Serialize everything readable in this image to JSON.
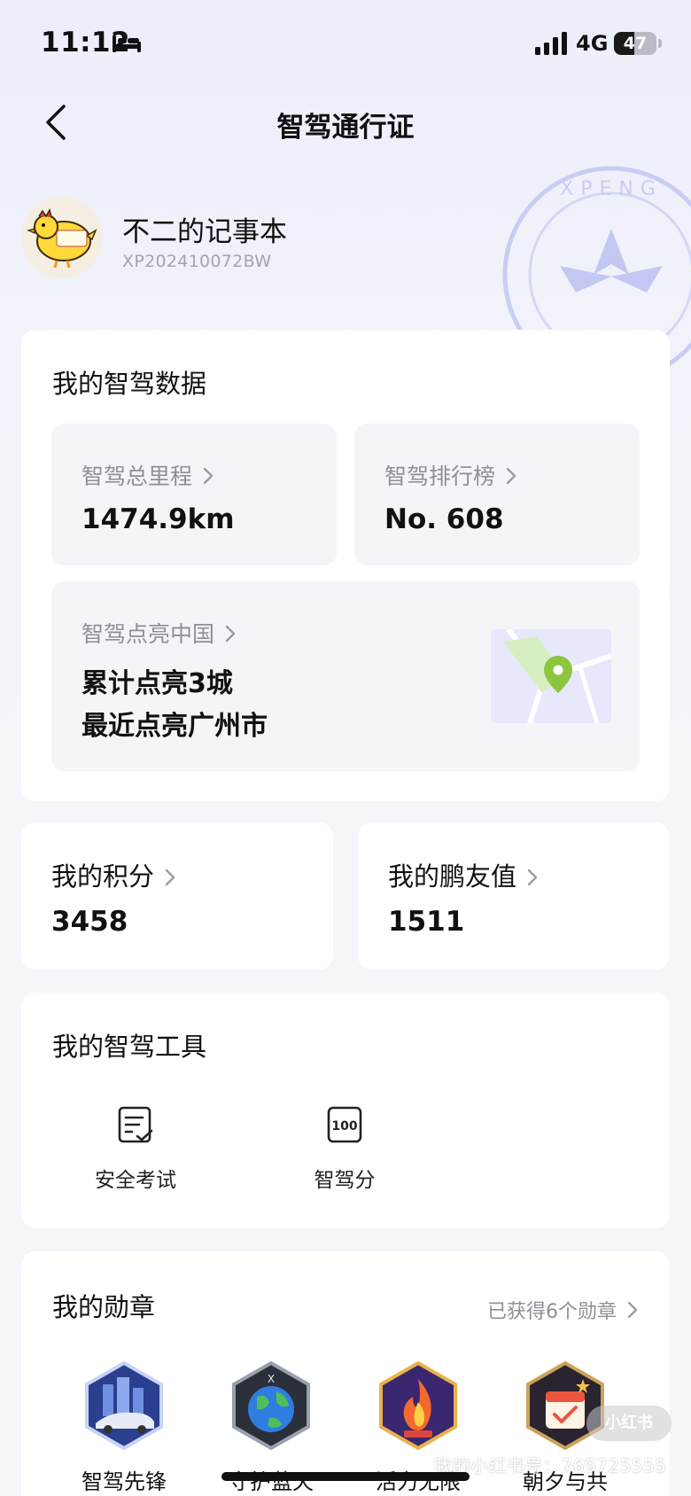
{
  "status_bar": {
    "time": "11:12",
    "network": "4G",
    "battery": "47",
    "battery_level": 0.47
  },
  "nav": {
    "title": "智驾通行证"
  },
  "profile": {
    "name": "不二的记事本",
    "id": "XP202410072BW"
  },
  "data_card": {
    "title": "我的智驾数据",
    "mileage": {
      "label": "智驾总里程",
      "value": "1474.9km"
    },
    "ranking": {
      "label": "智驾排行榜",
      "value": "No. 608"
    },
    "light_up": {
      "label": "智驾点亮中国",
      "line1": "累计点亮3城",
      "line2": "最近点亮广州市"
    }
  },
  "points": {
    "label": "我的积分",
    "value": "3458"
  },
  "friends": {
    "label": "我的鹏友值",
    "value": "1511"
  },
  "tools": {
    "title": "我的智驾工具",
    "items": [
      {
        "label": "安全考试",
        "icon": "exam-icon"
      },
      {
        "label": "智驾分",
        "icon": "score-100-icon",
        "icon_text": "100"
      }
    ]
  },
  "medals": {
    "title": "我的勋章",
    "count_text": "已获得6个勋章",
    "items": [
      {
        "label": "智驾先锋",
        "icon": "car-city-medal-icon"
      },
      {
        "label": "守护蓝天",
        "icon": "earth-medal-icon"
      },
      {
        "label": "活力无限",
        "icon": "flame-medal-icon"
      },
      {
        "label": "朝夕与共",
        "icon": "calendar-medal-icon"
      }
    ]
  },
  "overlay": {
    "watermark_text": "我的小红书号：769725555"
  },
  "colors": {
    "accent_green": "#8cc63f",
    "map_green": "#d7eec1",
    "tile_bg": "#f4f5f9",
    "page_bg": "#f5f6fa"
  }
}
